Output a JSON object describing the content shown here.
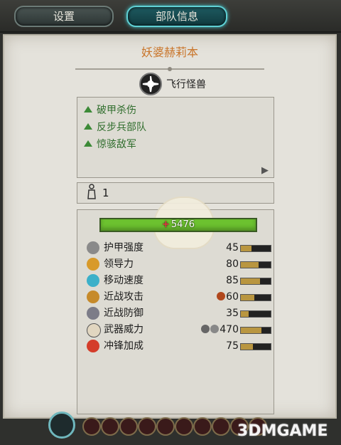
{
  "tabs": {
    "settings": "设置",
    "unit_info": "部队信息"
  },
  "unit": {
    "name": "妖婆赫莉本",
    "type": "飞行怪兽"
  },
  "attributes": [
    "破甲杀伤",
    "反步兵部队",
    "惊骇敌军"
  ],
  "model_count": "1",
  "health": {
    "label": "5476"
  },
  "stats": {
    "armor": {
      "label": "护甲强度",
      "value": "45",
      "fill": 0.35
    },
    "leadership": {
      "label": "领导力",
      "value": "80",
      "fill": 0.6
    },
    "speed": {
      "label": "移动速度",
      "value": "85",
      "fill": 0.65
    },
    "melee_attack": {
      "label": "近战攻击",
      "value": "60",
      "fill": 0.45
    },
    "melee_defence": {
      "label": "近战防御",
      "value": "35",
      "fill": 0.25
    },
    "weapon_strength": {
      "label": "武器威力",
      "value": "470",
      "fill": 0.7
    },
    "charge_bonus": {
      "label": "冲锋加成",
      "value": "75",
      "fill": 0.4
    }
  },
  "watermark": "3DMGAME",
  "colors": {
    "title": "#c9752a",
    "attribute": "#2f6d2c",
    "health": "#6cc22f",
    "tab_active": "#5fd0d4",
    "stat_bar": "#b99640"
  }
}
